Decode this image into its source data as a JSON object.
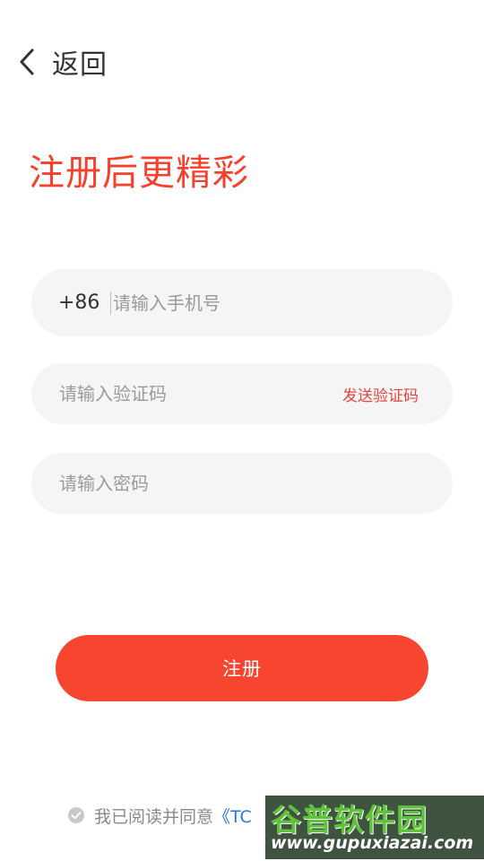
{
  "header": {
    "back_label": "返回",
    "back_icon": "chevron-left-icon"
  },
  "title": "注册后更精彩",
  "form": {
    "country_code": "+86",
    "phone_placeholder": "请输入手机号",
    "code_placeholder": "请输入验证码",
    "send_code_label": "发送验证码",
    "password_placeholder": "请输入密码"
  },
  "register_label": "注册",
  "agreement": {
    "prefix": "我已阅读并同意",
    "link": "《TC"
  },
  "watermark": {
    "title": "谷普软件园",
    "url": "www.gupuxiazai.com"
  },
  "colors": {
    "accent": "#f74530",
    "title": "#f5412d",
    "link": "#2b79e0",
    "input_bg": "#f5f5f5"
  }
}
